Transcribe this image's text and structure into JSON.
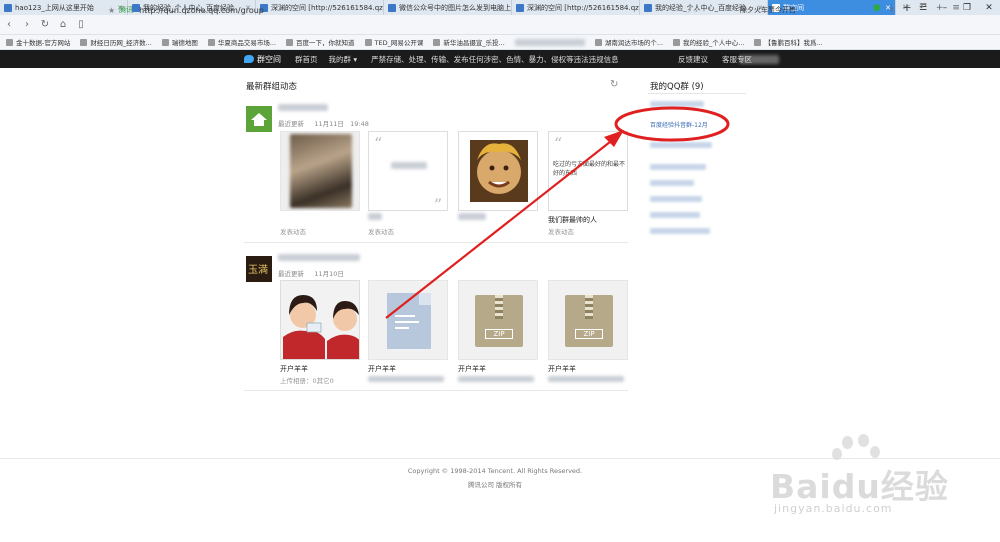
{
  "browser": {
    "tabs": [
      {
        "label": "hao123_上网从这里开始"
      },
      {
        "label": "我的经验_个人中心_百度经验"
      },
      {
        "label": "深渊的空间 [http://526161584.qzone..."
      },
      {
        "label": "微信公众号中的图片怎么发到电脑上_百..."
      },
      {
        "label": "深渊的空间 [http://526161584.qzone..."
      },
      {
        "label": "我的经验_个人中心_百度经验"
      },
      {
        "label": "群空间"
      }
    ],
    "url_secure_label": "腾讯",
    "url": "http://qun.qzone.qq.com/group",
    "search_text": "除夕火车票今开售",
    "bookmarks": [
      "金十数据-官方网站",
      "财经日历网_经济数...",
      "瑞德地图",
      "华夏商品交易市场...",
      "百度一下，你就知道",
      "TED_网易公开课",
      "新华油昌摄宣_乐投...",
      "湖南润达市场的个...",
      "我的经验_个人中心...",
      "【鲁鹏百科】我爲..."
    ]
  },
  "sitenav": {
    "logo": "群空间",
    "items": [
      "群首页",
      "我的群 ▾"
    ],
    "notice": "严禁存储、处理、传输、发布任何涉密、色情、暴力、侵权等违法违规信息",
    "right": [
      "反馈建议",
      "客服专区"
    ]
  },
  "main": {
    "section_title": "最新群组动态",
    "groups": [
      {
        "meta_prefix": "最近更新",
        "date": "11月11日",
        "time": "19:48",
        "cards": [
          {
            "caption": "",
            "sub": "发表动态"
          },
          {
            "caption": "",
            "sub": "发表动态"
          },
          {
            "caption": "",
            "sub": ""
          },
          {
            "caption": "我们群最帅的人",
            "sub": "发表动态",
            "quote_text": "吃过的亏方面最好的和最不好的东西"
          }
        ]
      },
      {
        "meta_prefix": "最近更新",
        "date": "11月10日",
        "time": "",
        "cards": [
          {
            "caption": "开户羊羊",
            "sub": "上传相册：0其它0"
          },
          {
            "caption": "开户羊羊",
            "sub": ""
          },
          {
            "caption": "开户羊羊",
            "sub": "",
            "zip_label": "ZIP"
          },
          {
            "caption": "开户羊羊",
            "sub": "",
            "zip_label": "ZIP"
          }
        ]
      }
    ]
  },
  "sidebar": {
    "title": "我的QQ群 (9)",
    "highlight_link": "百度经验抖音群-12月"
  },
  "footer": {
    "copyright": "Copyright © 1998-2014 Tencent. All Rights Reserved.",
    "company": "腾讯公司 版权所有"
  },
  "watermark": {
    "brand": "Baidu经验",
    "domain": "jingyan.baidu.com"
  },
  "colors": {
    "accent": "#3d8de0",
    "annotation": "#e02020",
    "nav_bg": "#1b1b1b"
  }
}
